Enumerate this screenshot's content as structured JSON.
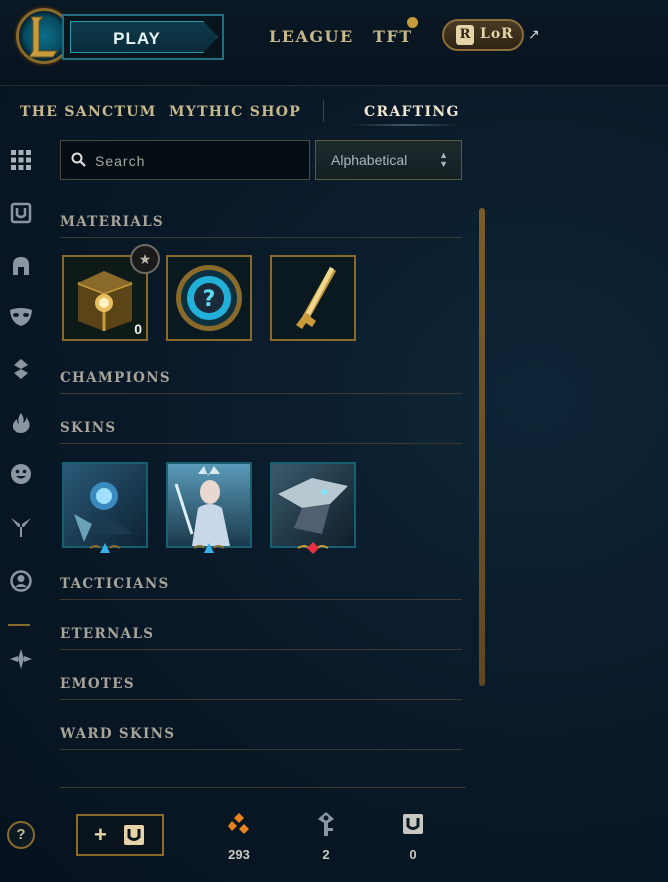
{
  "topbar": {
    "play_label": "PLAY",
    "nav": [
      {
        "label": "LEAGUE"
      },
      {
        "label": "TFT"
      }
    ],
    "lor_label": "LoR",
    "lor_badge": "R"
  },
  "subnav": {
    "items": [
      {
        "label": "THE SANCTUM"
      },
      {
        "label": "MYTHIC SHOP"
      },
      {
        "label": "CRAFTING",
        "active": true
      }
    ]
  },
  "search": {
    "placeholder": "Search"
  },
  "sort": {
    "selected": "Alphabetical"
  },
  "sections": [
    {
      "title": "MATERIALS"
    },
    {
      "title": "CHAMPIONS"
    },
    {
      "title": "SKINS"
    },
    {
      "title": "TACTICIANS"
    },
    {
      "title": "ETERNALS"
    },
    {
      "title": "EMOTES"
    },
    {
      "title": "WARD SKINS"
    }
  ],
  "materials": [
    {
      "name": "chest-icon",
      "count": "0",
      "badge": "★"
    },
    {
      "name": "mystery-orb-icon"
    },
    {
      "name": "key-icon"
    }
  ],
  "skins": [
    {
      "name": "skin-1",
      "rarity": "epic"
    },
    {
      "name": "skin-2",
      "rarity": "epic"
    },
    {
      "name": "skin-3",
      "rarity": "legendary"
    }
  ],
  "footer": {
    "help": "?",
    "add_label": "+",
    "currencies": [
      {
        "icon": "orange-essence-icon",
        "value": "293"
      },
      {
        "icon": "key-fragment-icon",
        "value": "2"
      },
      {
        "icon": "mythic-essence-icon",
        "value": "0"
      }
    ]
  },
  "colors": {
    "gold": "#c8b98c",
    "accent_gold": "#8a6a2a",
    "teal": "#1f6f7f",
    "background": "#0a1a29"
  }
}
